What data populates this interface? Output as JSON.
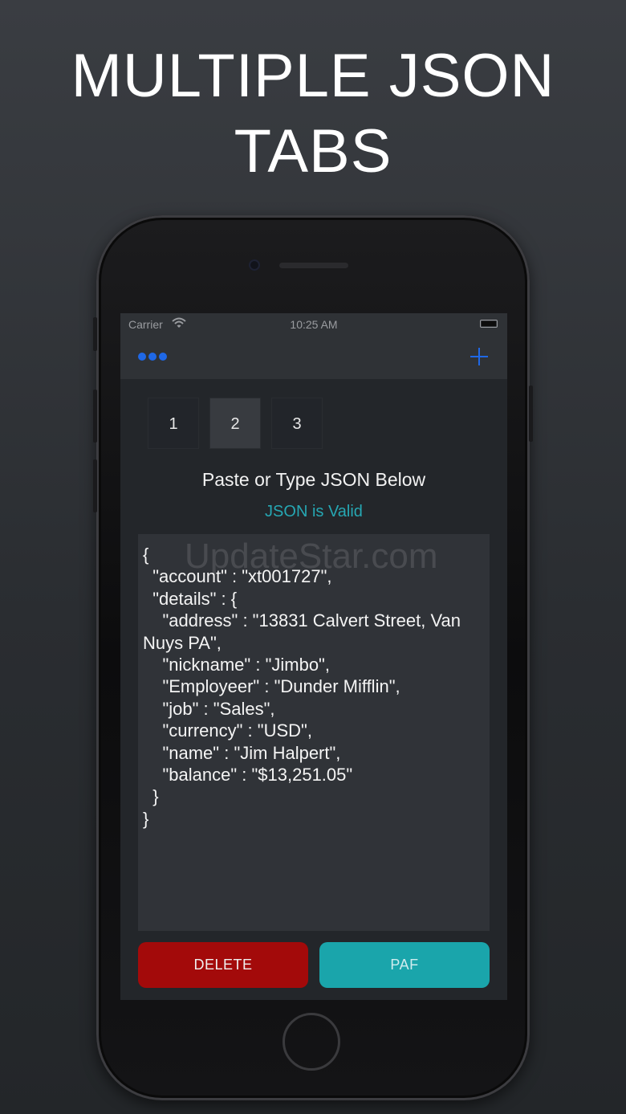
{
  "headline": {
    "line1": "MULTIPLE JSON",
    "line2": "TABS"
  },
  "status_bar": {
    "carrier": "Carrier",
    "time": "10:25 AM"
  },
  "nav": {
    "more_icon": "ellipsis-icon",
    "add_icon": "plus-icon"
  },
  "tabs": [
    {
      "label": "1",
      "active": false
    },
    {
      "label": "2",
      "active": true
    },
    {
      "label": "3",
      "active": false
    }
  ],
  "main": {
    "prompt": "Paste or Type JSON Below",
    "status": "JSON is Valid",
    "editor_text": "{\n  \"account\" : \"xt001727\",\n  \"details\" : {\n    \"address\" : \"13831 Calvert Street, Van Nuys PA\",\n    \"nickname\" : \"Jimbo\",\n    \"Employeer\" : \"Dunder Mifflin\",\n    \"job\" : \"Sales\",\n    \"currency\" : \"USD\",\n    \"name\" : \"Jim Halpert\",\n    \"balance\" : \"$13,251.05\"\n  }\n}",
    "watermark": "UpdateStar.com"
  },
  "buttons": {
    "delete_label": "DELETE",
    "parse_label": "PAF"
  },
  "colors": {
    "accent_blue": "#1f68e6",
    "valid_teal": "#26a7b3",
    "delete_red": "#a30a0a",
    "parse_teal": "#1aa5ab"
  }
}
